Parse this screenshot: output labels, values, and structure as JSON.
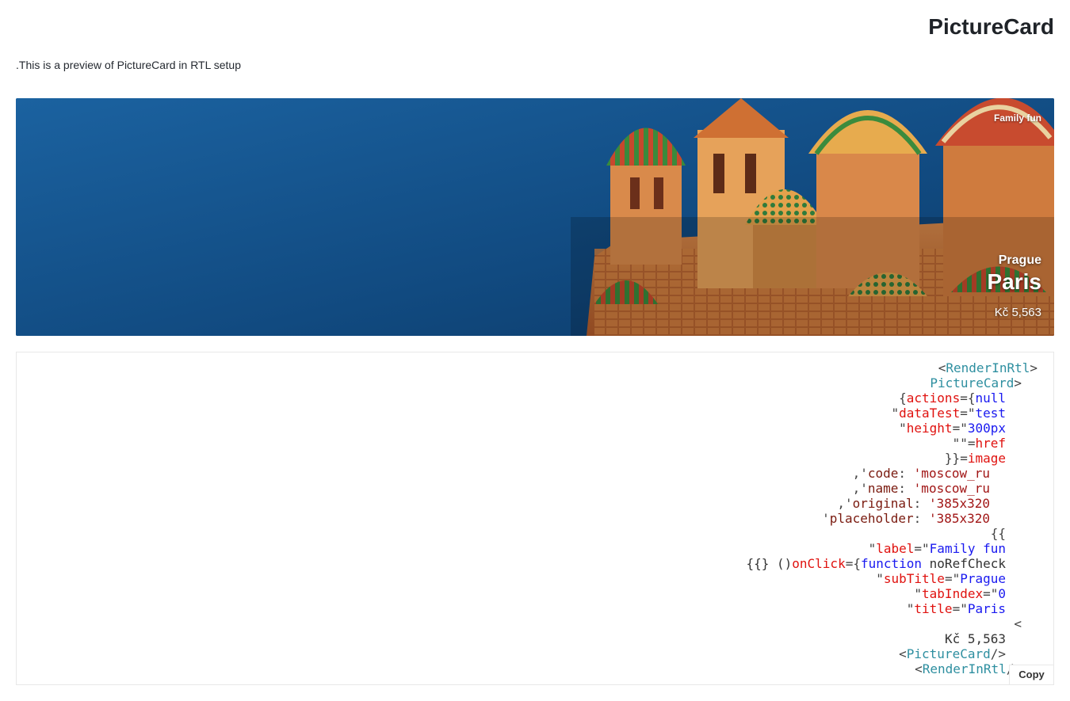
{
  "page": {
    "title": "PictureCard",
    "description": ".This is a preview of PictureCard in RTL setup"
  },
  "card": {
    "label": "Family fun",
    "subtitle": "Prague",
    "title": "Paris",
    "price": "Kč 5,563"
  },
  "code": {
    "l1_a": "<",
    "l1_b": "RenderInRtl",
    "l1_c": ">",
    "l2_a": "PictureCard",
    "l2_b": ">",
    "l3_a": "{",
    "l3_b": "actions",
    "l3_c": "={",
    "l3_d": "null",
    "l4_a": "\"",
    "l4_b": "dataTest",
    "l4_c": "=\"",
    "l4_d": "test",
    "l5_a": "\"",
    "l5_b": "height",
    "l5_c": "=\"",
    "l5_d": "300px",
    "l6_a": "\"\"=",
    "l6_b": "href",
    "l7_a": "}}=",
    "l7_b": "image",
    "l8_a": ",'",
    "l8_b": "code",
    "l8_c": ": ",
    "l8_d": "'moscow_ru",
    "l9_a": ",'",
    "l9_b": "name",
    "l9_c": ": ",
    "l9_d": "'moscow_ru",
    "l10_a": ",'",
    "l10_b": "original",
    "l10_c": ": ",
    "l10_d": "'385x320",
    "l11_a": "'",
    "l11_b": "placeholder",
    "l11_c": ": ",
    "l11_d": "'385x320",
    "l12_a": "{{",
    "l13_a": "\"",
    "l13_b": "label",
    "l13_c": "=\"",
    "l13_d": "Family fun",
    "l14_a": "{{} ()",
    "l14_b": "onClick",
    "l14_c": "={",
    "l14_d": "function",
    "l14_e": " noRefCheck",
    "l15_a": "\"",
    "l15_b": "subTitle",
    "l15_c": "=\"",
    "l15_d": "Prague",
    "l16_a": "\"",
    "l16_b": "tabIndex",
    "l16_c": "=\"",
    "l16_d": "0",
    "l17_a": "\"",
    "l17_b": "title",
    "l17_c": "=\"",
    "l17_d": "Paris",
    "l18_a": "<",
    "l19_a": "Kč 5,563",
    "l20_a": "<",
    "l20_b": "PictureCard",
    "l20_c": "/>",
    "l21_a": "<",
    "l21_b": "RenderInRtl",
    "l21_c": "/>"
  },
  "copy_label": "Copy"
}
